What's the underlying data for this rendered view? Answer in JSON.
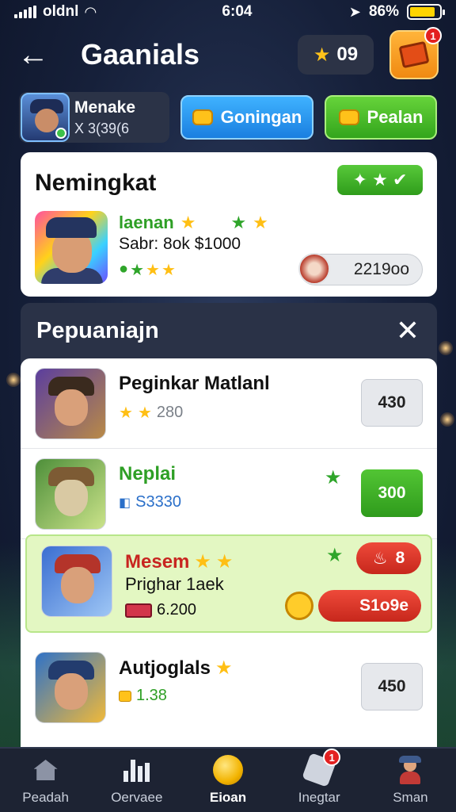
{
  "status_bar": {
    "carrier": "oldnl",
    "time": "6:04",
    "battery": "86%"
  },
  "header": {
    "title": "Gaanials",
    "currency_value": "09",
    "chest_badge": "1"
  },
  "profile": {
    "name": "Menake",
    "id": "X 3(39(6"
  },
  "actions": {
    "primary_label": "Goningan",
    "secondary_label": "Pealan"
  },
  "featured": {
    "title": "Nemingkat",
    "badge_label": "✦ ★ ✔",
    "hero_name": "laenan",
    "detail_line": "Sabr: 8ok $1000",
    "price": "2219oo"
  },
  "panel": {
    "title": "Pepuaniajn",
    "close_label": "✕",
    "items": [
      {
        "name": "Peginkar Matlanl",
        "sub": "280",
        "price": "430"
      },
      {
        "name": "Neplai",
        "sub": "S3330",
        "price": "300"
      },
      {
        "name": "Mesem",
        "line2": "Prighar 1aek",
        "sub": "6.200",
        "badge": "8",
        "price": "S1o9e"
      },
      {
        "name": "Autjoglals",
        "sub": "1.38",
        "price": "450"
      }
    ]
  },
  "nav": {
    "items": [
      {
        "label": "Peadah"
      },
      {
        "label": "Oervaee"
      },
      {
        "label": "Eioan"
      },
      {
        "label": "Inegtar",
        "badge": "1"
      },
      {
        "label": "Sman"
      }
    ]
  },
  "colors": {
    "accent_blue": "#1a7fe0",
    "accent_green": "#33a51c",
    "highlight": "#e3f7c2",
    "danger": "#c7271c"
  }
}
